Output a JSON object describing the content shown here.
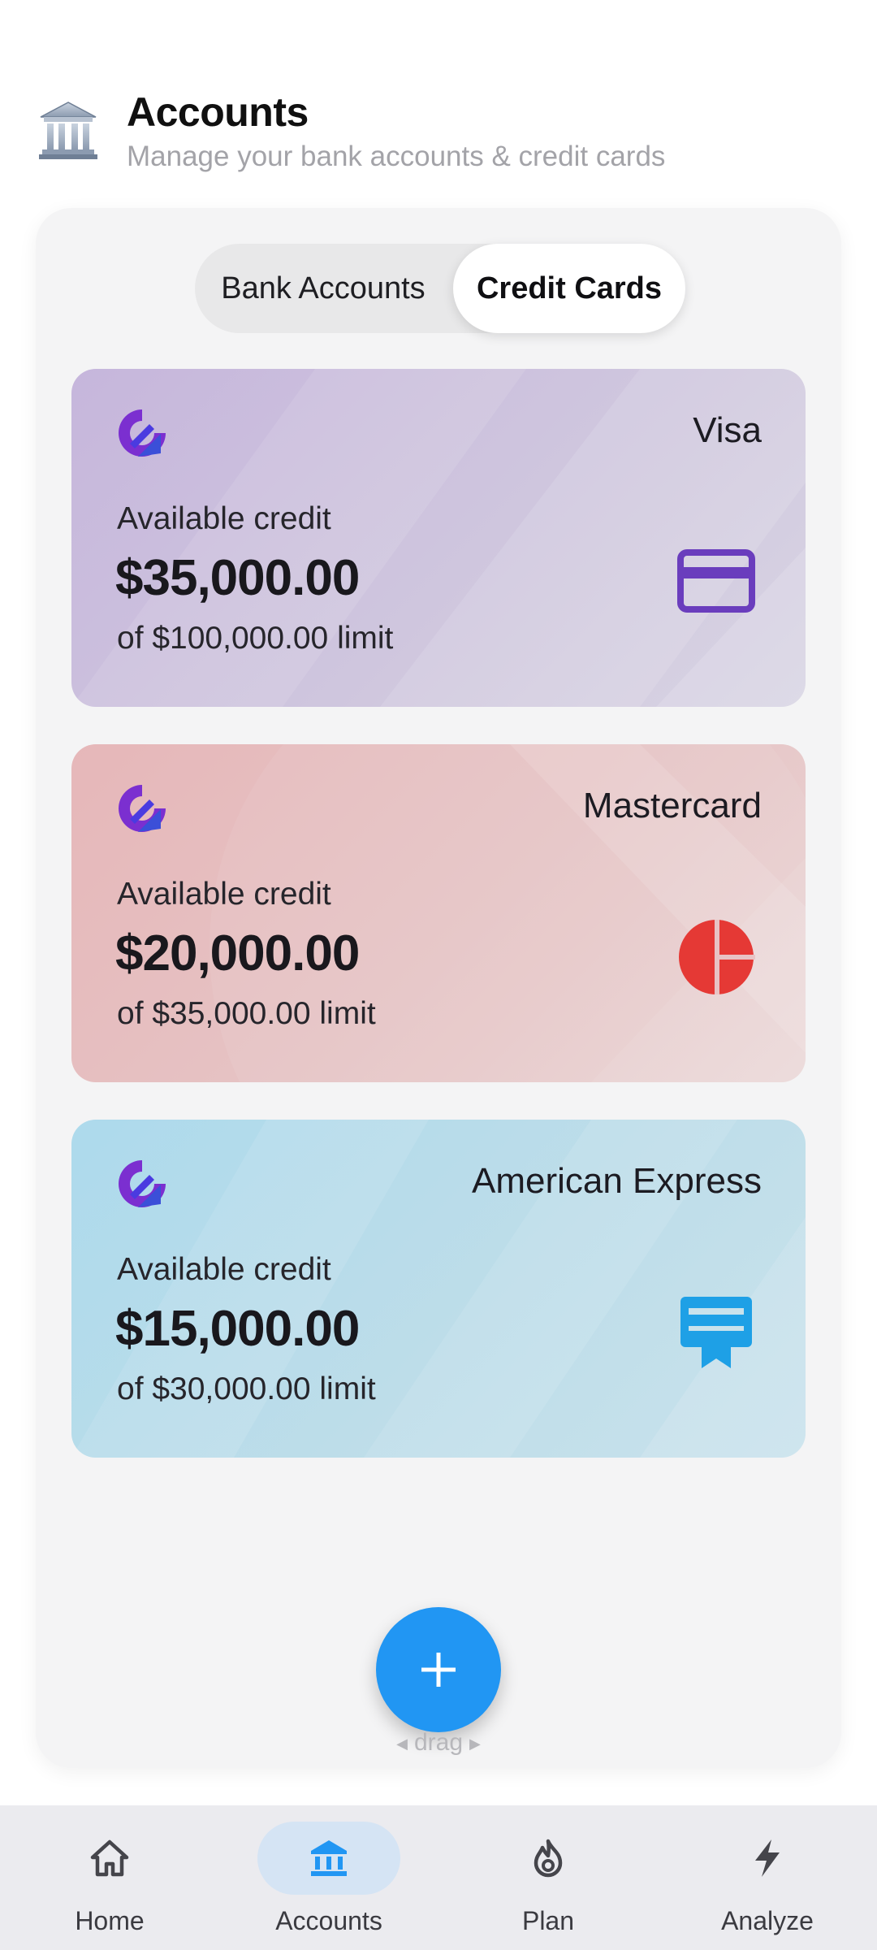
{
  "header": {
    "title": "Accounts",
    "subtitle": "Manage your bank accounts & credit cards",
    "icon": "bank-building-icon"
  },
  "tabs": [
    {
      "label": "Bank Accounts",
      "selected": false
    },
    {
      "label": "Credit Cards",
      "selected": true
    }
  ],
  "cards": [
    {
      "brand": "Visa",
      "available_label": "Available credit",
      "amount": "$35,000.00",
      "limit": "of $100,000.00 limit",
      "icon": "credit-card-icon",
      "accent": "#6a3dbd",
      "tint": "#c6b6dc"
    },
    {
      "brand": "Mastercard",
      "available_label": "Available credit",
      "amount": "$20,000.00",
      "limit": "of $35,000.00 limit",
      "icon": "pie-circle-icon",
      "accent": "#e53935",
      "tint": "#e6b7b9"
    },
    {
      "brand": "American Express",
      "available_label": "Available credit",
      "amount": "$15,000.00",
      "limit": "of $30,000.00 limit",
      "icon": "card-membership-icon",
      "accent": "#1ea0e6",
      "tint": "#addaec"
    }
  ],
  "fab": {
    "icon": "plus-icon",
    "hint": "drag",
    "color": "#2196f3"
  },
  "bottom_nav": [
    {
      "label": "Home",
      "icon": "home-icon",
      "active": false
    },
    {
      "label": "Accounts",
      "icon": "bank-icon",
      "active": true
    },
    {
      "label": "Plan",
      "icon": "flame-icon",
      "active": false
    },
    {
      "label": "Analyze",
      "icon": "bolt-icon",
      "active": false
    }
  ],
  "colors": {
    "accent_blue": "#2196f3",
    "logo_purple": "#7b2fd0",
    "logo_blue": "#3b4fd8"
  }
}
